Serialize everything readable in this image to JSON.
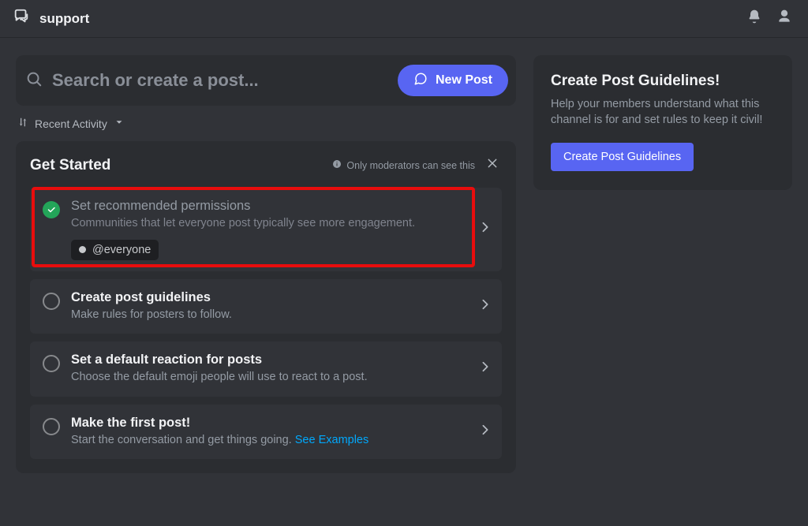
{
  "header": {
    "channel_name": "support"
  },
  "search": {
    "placeholder": "Search or create a post...",
    "new_post_label": "New Post"
  },
  "sort": {
    "label": "Recent Activity"
  },
  "get_started": {
    "title": "Get Started",
    "moderator_note": "Only moderators can see this",
    "steps": {
      "permissions": {
        "title": "Set recommended permissions",
        "desc": "Communities that let everyone post typically see more engagement.",
        "chip": "@everyone",
        "completed": true
      },
      "guidelines": {
        "title": "Create post guidelines",
        "desc": "Make rules for posters to follow.",
        "completed": false
      },
      "reaction": {
        "title": "Set a default reaction for posts",
        "desc": "Choose the default emoji people will use to react to a post.",
        "completed": false
      },
      "first_post": {
        "title": "Make the first post!",
        "desc_prefix": "Start the conversation and get things going. ",
        "link_text": "See Examples",
        "completed": false
      }
    }
  },
  "sidebar": {
    "title": "Create Post Guidelines!",
    "desc": "Help your members understand what this channel is for and set rules to keep it civil!",
    "button": "Create Post Guidelines"
  },
  "colors": {
    "accent": "#5865f2",
    "success": "#23a559",
    "highlight": "#e80d0d"
  }
}
